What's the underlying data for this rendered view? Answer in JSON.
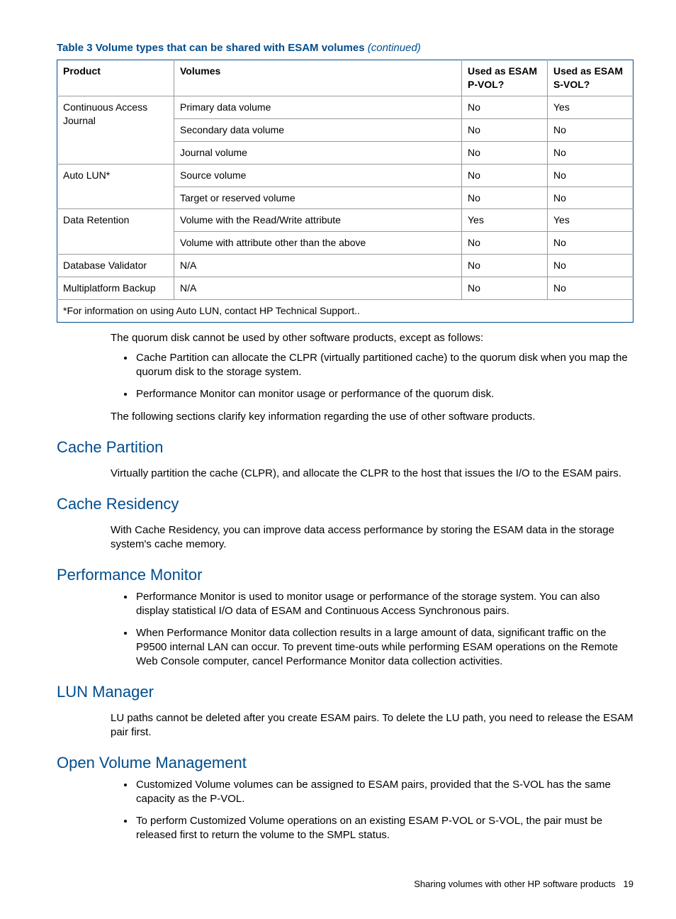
{
  "table": {
    "caption_prefix": "Table 3 Volume types that can be shared with ESAM volumes ",
    "caption_suffix": "(continued)",
    "headers": [
      "Product",
      "Volumes",
      "Used as ESAM P-VOL?",
      "Used as ESAM S-VOL?"
    ],
    "rows": [
      {
        "product": "Continuous Access Journal",
        "rowspan": 3,
        "volume": "Primary data volume",
        "pvol": "No",
        "svol": "Yes"
      },
      {
        "volume": "Secondary data volume",
        "pvol": "No",
        "svol": "No"
      },
      {
        "volume": "Journal volume",
        "pvol": "No",
        "svol": "No"
      },
      {
        "product": "Auto LUN*",
        "rowspan": 2,
        "volume": "Source volume",
        "pvol": "No",
        "svol": "No"
      },
      {
        "volume": "Target or reserved volume",
        "pvol": "No",
        "svol": "No"
      },
      {
        "product": "Data Retention",
        "rowspan": 2,
        "volume": "Volume with the Read/Write attribute",
        "pvol": "Yes",
        "svol": "Yes"
      },
      {
        "volume": "Volume with attribute other than the above",
        "pvol": "No",
        "svol": "No"
      },
      {
        "product": "Database Validator",
        "rowspan": 1,
        "volume": "N/A",
        "pvol": "No",
        "svol": "No"
      },
      {
        "product": "Multiplatform Backup",
        "rowspan": 1,
        "volume": "N/A",
        "pvol": "No",
        "svol": "No"
      }
    ],
    "footnote": "*For information on using Auto LUN, contact HP Technical Support.."
  },
  "intro_para": "The quorum disk cannot be used by other software products, except as follows:",
  "intro_bullets": [
    "Cache Partition can allocate the CLPR (virtually partitioned cache) to the quorum disk when you map the quorum disk to the storage system.",
    "Performance Monitor can monitor usage or performance of the quorum disk."
  ],
  "intro_closing": "The following sections clarify key information regarding the use of other software products.",
  "sections": [
    {
      "title": "Cache Partition",
      "para": "Virtually partition the cache (CLPR), and allocate the CLPR to the host that issues the I/O to the ESAM pairs."
    },
    {
      "title": "Cache Residency",
      "para": "With Cache Residency, you can improve data access performance by storing the ESAM data in the storage system's cache memory."
    },
    {
      "title": "Performance Monitor",
      "bullets": [
        "Performance Monitor is used to monitor usage or performance of the storage system. You can also display statistical I/O data of ESAM and Continuous Access Synchronous pairs.",
        "When Performance Monitor data collection results in a large amount of data, significant traffic on the P9500 internal LAN can occur. To prevent time-outs while performing ESAM operations on the Remote Web Console computer, cancel Performance Monitor data collection activities."
      ]
    },
    {
      "title": "LUN Manager",
      "para": "LU paths cannot be deleted after you create ESAM pairs. To delete the LU path, you need to release the ESAM pair first."
    },
    {
      "title": "Open Volume Management",
      "bullets": [
        "Customized Volume volumes can be assigned to ESAM pairs, provided that the S-VOL has the same capacity as the P-VOL.",
        "To perform Customized Volume operations on an existing ESAM P-VOL or S-VOL, the pair must be released first to return the volume to the SMPL status."
      ]
    }
  ],
  "footer": {
    "text": "Sharing volumes with other HP software products",
    "page": "19"
  }
}
